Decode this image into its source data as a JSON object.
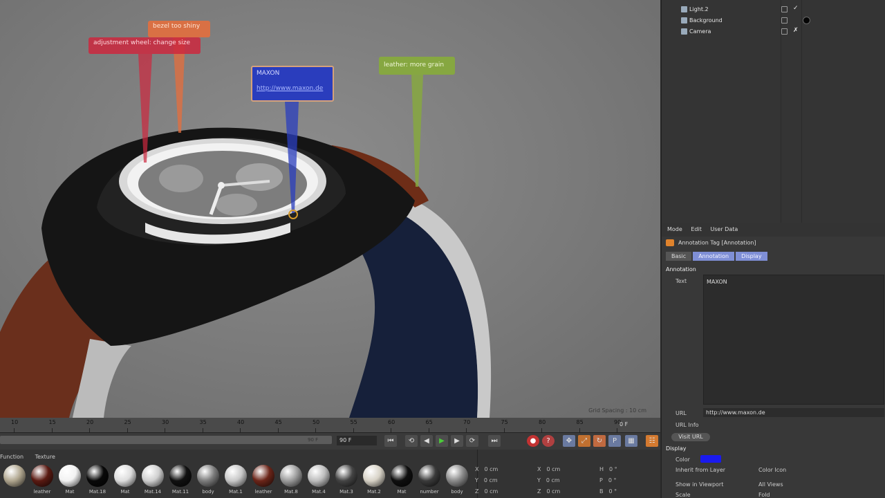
{
  "viewport": {
    "annotations": {
      "red": "adjustment wheel: change size",
      "orange": "bezel too shiny",
      "green": "leather: more grain",
      "blue_title": "MAXON",
      "blue_url": "http://www.maxon.de"
    },
    "grid_spacing": "Grid Spacing : 10 cm"
  },
  "timeline": {
    "ticks": [
      "10",
      "15",
      "20",
      "25",
      "30",
      "35",
      "40",
      "45",
      "50",
      "55",
      "60",
      "65",
      "70",
      "75",
      "80",
      "85",
      "90"
    ],
    "current_frame": "0 F",
    "scrub_end": "90 F",
    "end_field": "90 F",
    "buttons": [
      "go-start",
      "prev-key",
      "prev-frame",
      "play",
      "next-frame",
      "next-key",
      "go-end"
    ],
    "record_label": "●"
  },
  "materials": {
    "tabs": [
      "Function",
      "Texture"
    ],
    "items": [
      {
        "label": "",
        "color": "#b0a68f"
      },
      {
        "label": "leather",
        "color": "#5a1a12"
      },
      {
        "label": "Mat",
        "color": "#f2f2f2"
      },
      {
        "label": "Mat.18",
        "color": "#090909"
      },
      {
        "label": "Mat",
        "color": "#dddddd"
      },
      {
        "label": "Mat.14",
        "color": "#cfcfcf"
      },
      {
        "label": "Mat.11",
        "color": "#111111"
      },
      {
        "label": "body",
        "color": "#7c7c7c"
      },
      {
        "label": "Mat.1",
        "color": "#c8c8c8"
      },
      {
        "label": "leather",
        "color": "#6b2519"
      },
      {
        "label": "Mat.8",
        "color": "#9c9c9c"
      },
      {
        "label": "Mat.4",
        "color": "#bdbdbd"
      },
      {
        "label": "Mat.3",
        "color": "#444444"
      },
      {
        "label": "Mat.2",
        "color": "#d7d2c6"
      },
      {
        "label": "Mat",
        "color": "#0f0f0f"
      },
      {
        "label": "number",
        "color": "#3a3a3a"
      },
      {
        "label": "body",
        "color": "#8a8a8a"
      }
    ]
  },
  "coords": {
    "rows": [
      {
        "a": "X",
        "av": "0 cm",
        "b": "X",
        "bv": "0 cm",
        "c": "H",
        "cv": "0 °"
      },
      {
        "a": "Y",
        "av": "0 cm",
        "b": "Y",
        "bv": "0 cm",
        "c": "P",
        "cv": "0 °"
      },
      {
        "a": "Z",
        "av": "0 cm",
        "b": "Z",
        "bv": "0 cm",
        "c": "B",
        "cv": "0 °"
      }
    ]
  },
  "objects": {
    "items": [
      {
        "name": "Light.2",
        "check": "✓"
      },
      {
        "name": "Background",
        "check": ""
      },
      {
        "name": "Camera",
        "check": "✗"
      }
    ]
  },
  "attributes": {
    "menu": [
      "Mode",
      "Edit",
      "User Data"
    ],
    "title": "Annotation Tag [Annotation]",
    "tabs": [
      "Basic",
      "Annotation",
      "Display"
    ],
    "section_annotation": "Annotation",
    "text_label": "Text",
    "text_value": "MAXON",
    "url_label": "URL",
    "url_value": "http://www.maxon.de",
    "url_info_label": "URL Info",
    "visit_url": "Visit URL",
    "section_display": "Display",
    "color_label": "Color",
    "color_value": "#1a1aee",
    "inherit_label": "Inherit from Layer",
    "color_icon_label": "Color Icon",
    "show_viewport_label": "Show in Viewport",
    "all_views_label": "All Views",
    "scale_label": "Scale",
    "fold_label": "Fold"
  }
}
